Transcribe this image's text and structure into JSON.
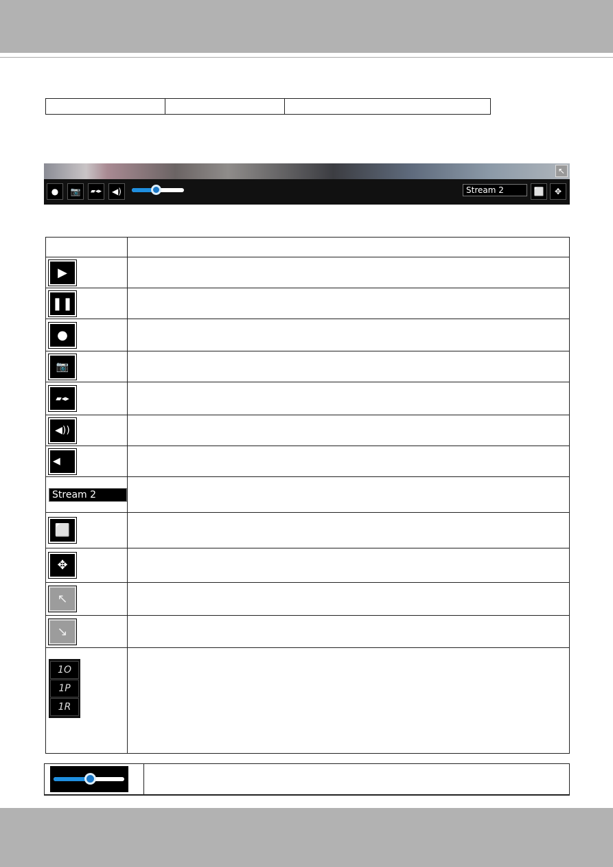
{
  "player": {
    "stream_label": "Stream 2",
    "volume_level": 0.45
  },
  "icons": [
    "play-icon",
    "pause-icon",
    "pin-icon",
    "snapshot-icon",
    "digital-zoom-icon",
    "speaker-icon",
    "mute-icon",
    "stream-selector",
    "fit-window-icon",
    "fullscreen-icon",
    "collapse-icon",
    "expand-icon",
    "preset-buttons"
  ],
  "table": {
    "stream_sample": "Stream 2",
    "preset_buttons": [
      "1O",
      "1P",
      "1R"
    ]
  },
  "slider_row": {
    "volume_level": 0.45
  },
  "colors": {
    "band": "#b2b2b2",
    "slider_fill": "#1f8fe0"
  }
}
